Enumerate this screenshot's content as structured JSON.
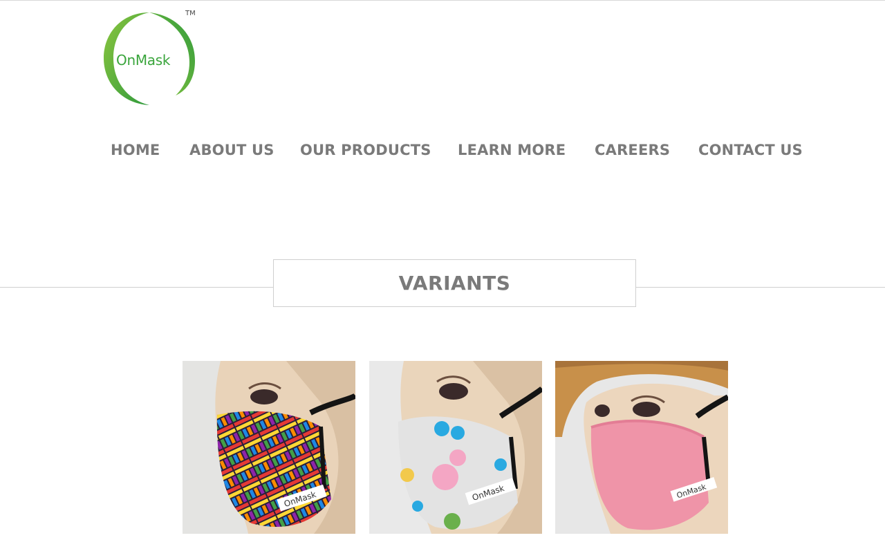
{
  "brand": {
    "logo_text": "OnMask",
    "trademark": "TM",
    "colors": {
      "green_dark": "#2f9a3c",
      "green_light": "#8cc63f"
    }
  },
  "nav": {
    "items": [
      {
        "label": "HOME"
      },
      {
        "label": "ABOUT US"
      },
      {
        "label": "OUR PRODUCTS"
      },
      {
        "label": "LEARN MORE"
      },
      {
        "label": "CAREERS"
      },
      {
        "label": "CONTACT US"
      }
    ]
  },
  "section": {
    "title": "VARIANTS"
  },
  "gallery": {
    "items": [
      {
        "icon": "multicolor-weave-mask-image",
        "label_text": "OnMask"
      },
      {
        "icon": "polka-dot-mask-image",
        "label_text": "OnMask"
      },
      {
        "icon": "pink-mask-image",
        "label_text": "OnMask"
      }
    ]
  }
}
